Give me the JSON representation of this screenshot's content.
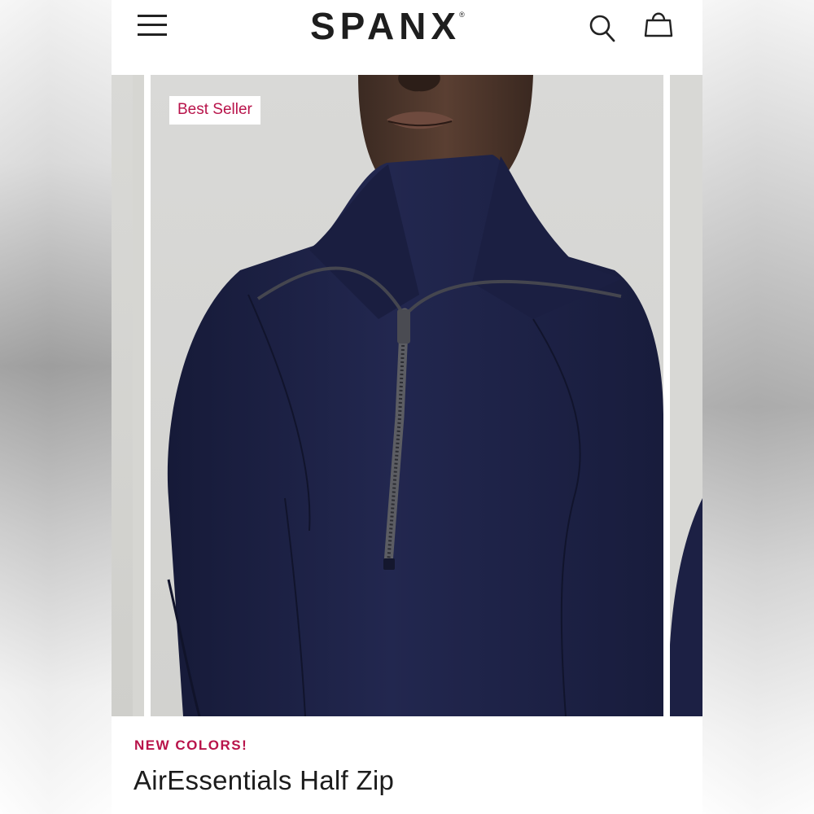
{
  "header": {
    "brand": "SPANX",
    "brand_mark": "®",
    "menu_icon": "hamburger-menu-icon",
    "search_icon": "search-icon",
    "bag_icon": "shopping-bag-icon"
  },
  "product": {
    "badge": "Best Seller",
    "eyebrow": "NEW COLORS!",
    "name": "AirEssentials Half Zip"
  },
  "colors": {
    "accent": "#b8134a",
    "garment": "#1d2246",
    "text": "#1c1c1c"
  }
}
